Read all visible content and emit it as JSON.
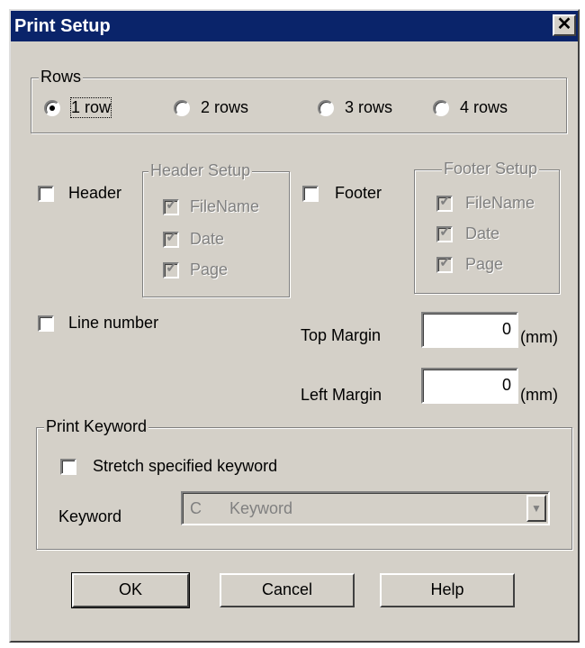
{
  "window": {
    "title": "Print Setup",
    "close_glyph": "✕"
  },
  "rows_group": {
    "label": "Rows",
    "options": [
      {
        "label": "1 row",
        "selected": true
      },
      {
        "label": "2 rows",
        "selected": false
      },
      {
        "label": "3 rows",
        "selected": false
      },
      {
        "label": "4 rows",
        "selected": false
      }
    ]
  },
  "header": {
    "checkbox_label": "Header",
    "checked": false,
    "setup_label": "Header Setup",
    "items": [
      "FileName",
      "Date",
      "Page"
    ]
  },
  "footer": {
    "checkbox_label": "Footer",
    "checked": false,
    "setup_label": "Footer Setup",
    "items": [
      "FileName",
      "Date",
      "Page"
    ]
  },
  "line_number": {
    "label": "Line number",
    "checked": false
  },
  "margins": {
    "top_label": "Top Margin",
    "top_value": "0",
    "left_label": "Left Margin",
    "left_value": "0",
    "unit": "(mm)"
  },
  "print_keyword": {
    "group_label": "Print Keyword",
    "stretch_label": "Stretch specified keyword",
    "stretch_checked": false,
    "keyword_label": "Keyword",
    "keyword_prefix": "C",
    "keyword_value": "Keyword"
  },
  "buttons": {
    "ok": "OK",
    "cancel": "Cancel",
    "help": "Help"
  }
}
